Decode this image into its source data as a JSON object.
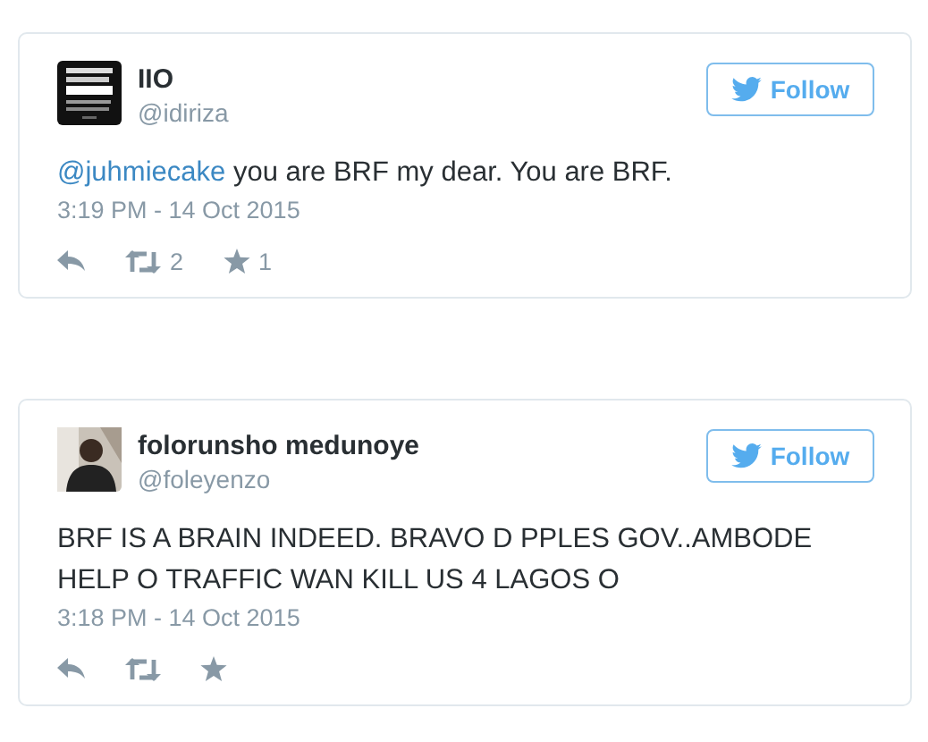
{
  "tweets": [
    {
      "avatar": {
        "kind": "picture"
      },
      "name": "IIO",
      "handle": "@idiriza",
      "follow_button": "Follow",
      "text": [
        {
          "kind": "mention",
          "text": "@juhmiecake"
        },
        {
          "kind": "plain",
          "text": " you are BRF my dear. You are BRF."
        }
      ],
      "time": "3:19 PM - 14 Oct 2015",
      "actions": [
        {
          "kind": "reply"
        },
        {
          "kind": "retweet",
          "count": "2"
        },
        {
          "kind": "favorite",
          "count": "1"
        }
      ]
    },
    {
      "avatar": {
        "kind": "person"
      },
      "name": "folorunsho medunoye",
      "handle": "@foleyenzo",
      "follow_button": "Follow",
      "text": [
        {
          "kind": "plain",
          "text": "BRF IS A BRAIN INDEED. BRAVO D PPLES GOV..AMBODE HELP O TRAFFIC WAN KILL US 4 LAGOS O"
        }
      ],
      "time": "3:18 PM - 14 Oct 2015",
      "actions": [
        {
          "kind": "reply"
        },
        {
          "kind": "retweet"
        },
        {
          "kind": "favorite"
        }
      ]
    }
  ]
}
